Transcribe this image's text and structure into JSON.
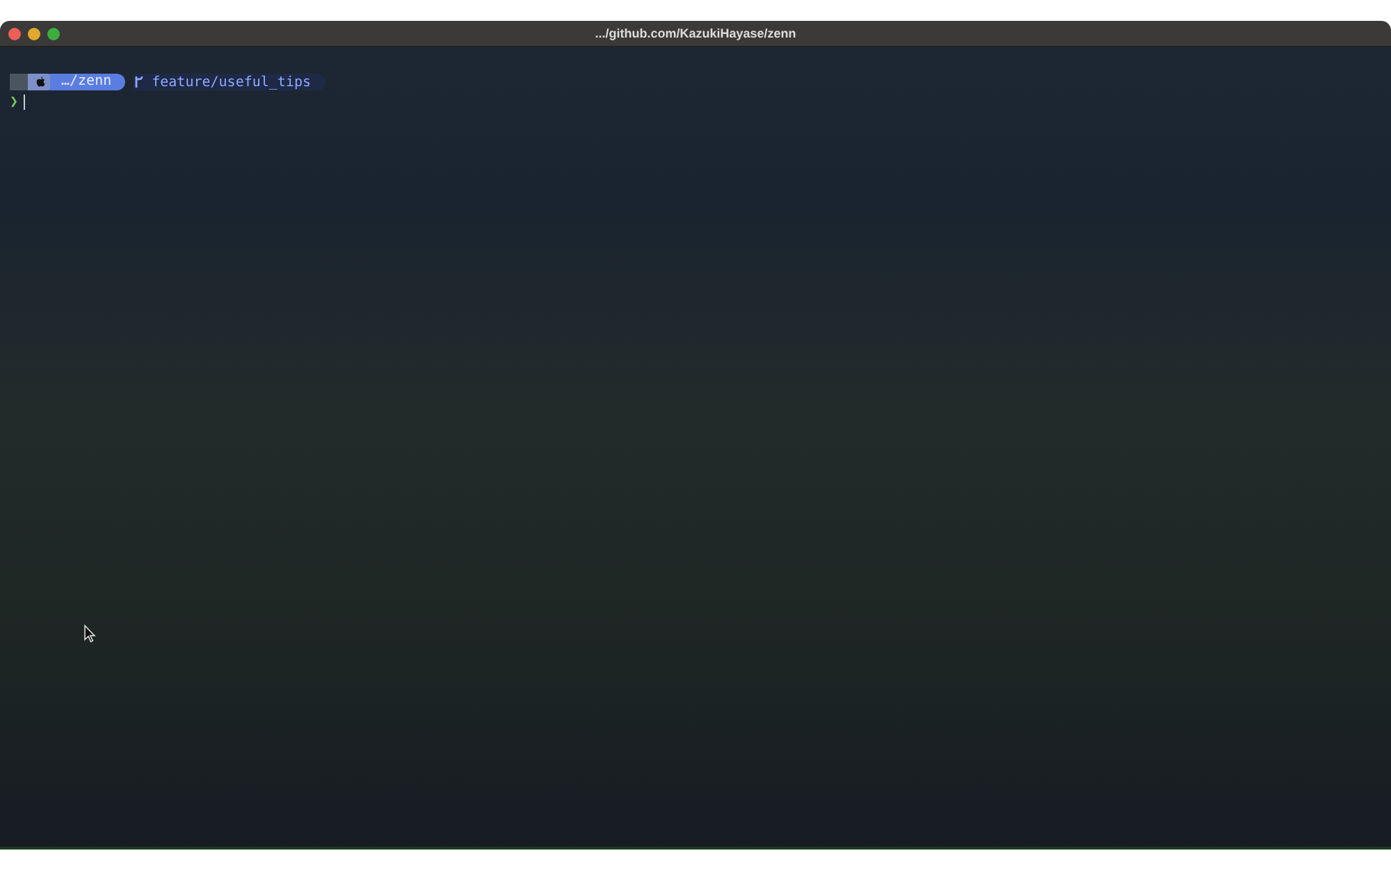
{
  "window": {
    "title": ".../github.com/KazukiHayase/zenn"
  },
  "prompt": {
    "path": "…/zenn",
    "branch": "feature/useful_tips"
  },
  "input_line": {
    "prompt_char": "❯"
  }
}
